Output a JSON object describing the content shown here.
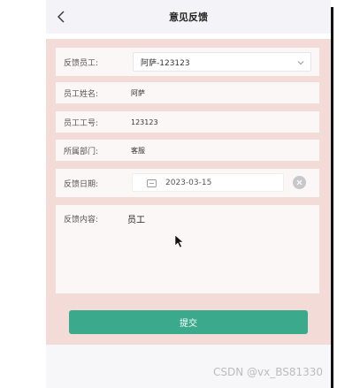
{
  "header": {
    "title": "意见反馈",
    "back_icon": "chevron-left-icon"
  },
  "form": {
    "employee": {
      "label": "反馈员工:",
      "value": "阿萨-123123",
      "icon": "chevron-down-icon"
    },
    "name": {
      "label": "员工姓名:",
      "value": "阿萨"
    },
    "number": {
      "label": "员工工号:",
      "value": "123123"
    },
    "department": {
      "label": "所属部门:",
      "value": "客服"
    },
    "date": {
      "label": "反馈日期:",
      "value": "2023-03-15",
      "icon": "calendar-icon",
      "clear_icon": "clear-icon"
    },
    "content": {
      "label": "反馈内容:",
      "value": "员工"
    }
  },
  "submit": {
    "label": "提交",
    "color": "#3aa98c"
  },
  "watermark": "CSDN @vx_BS81330",
  "colors": {
    "page_background": "#f3dcd8",
    "accent": "#3aa98c"
  }
}
